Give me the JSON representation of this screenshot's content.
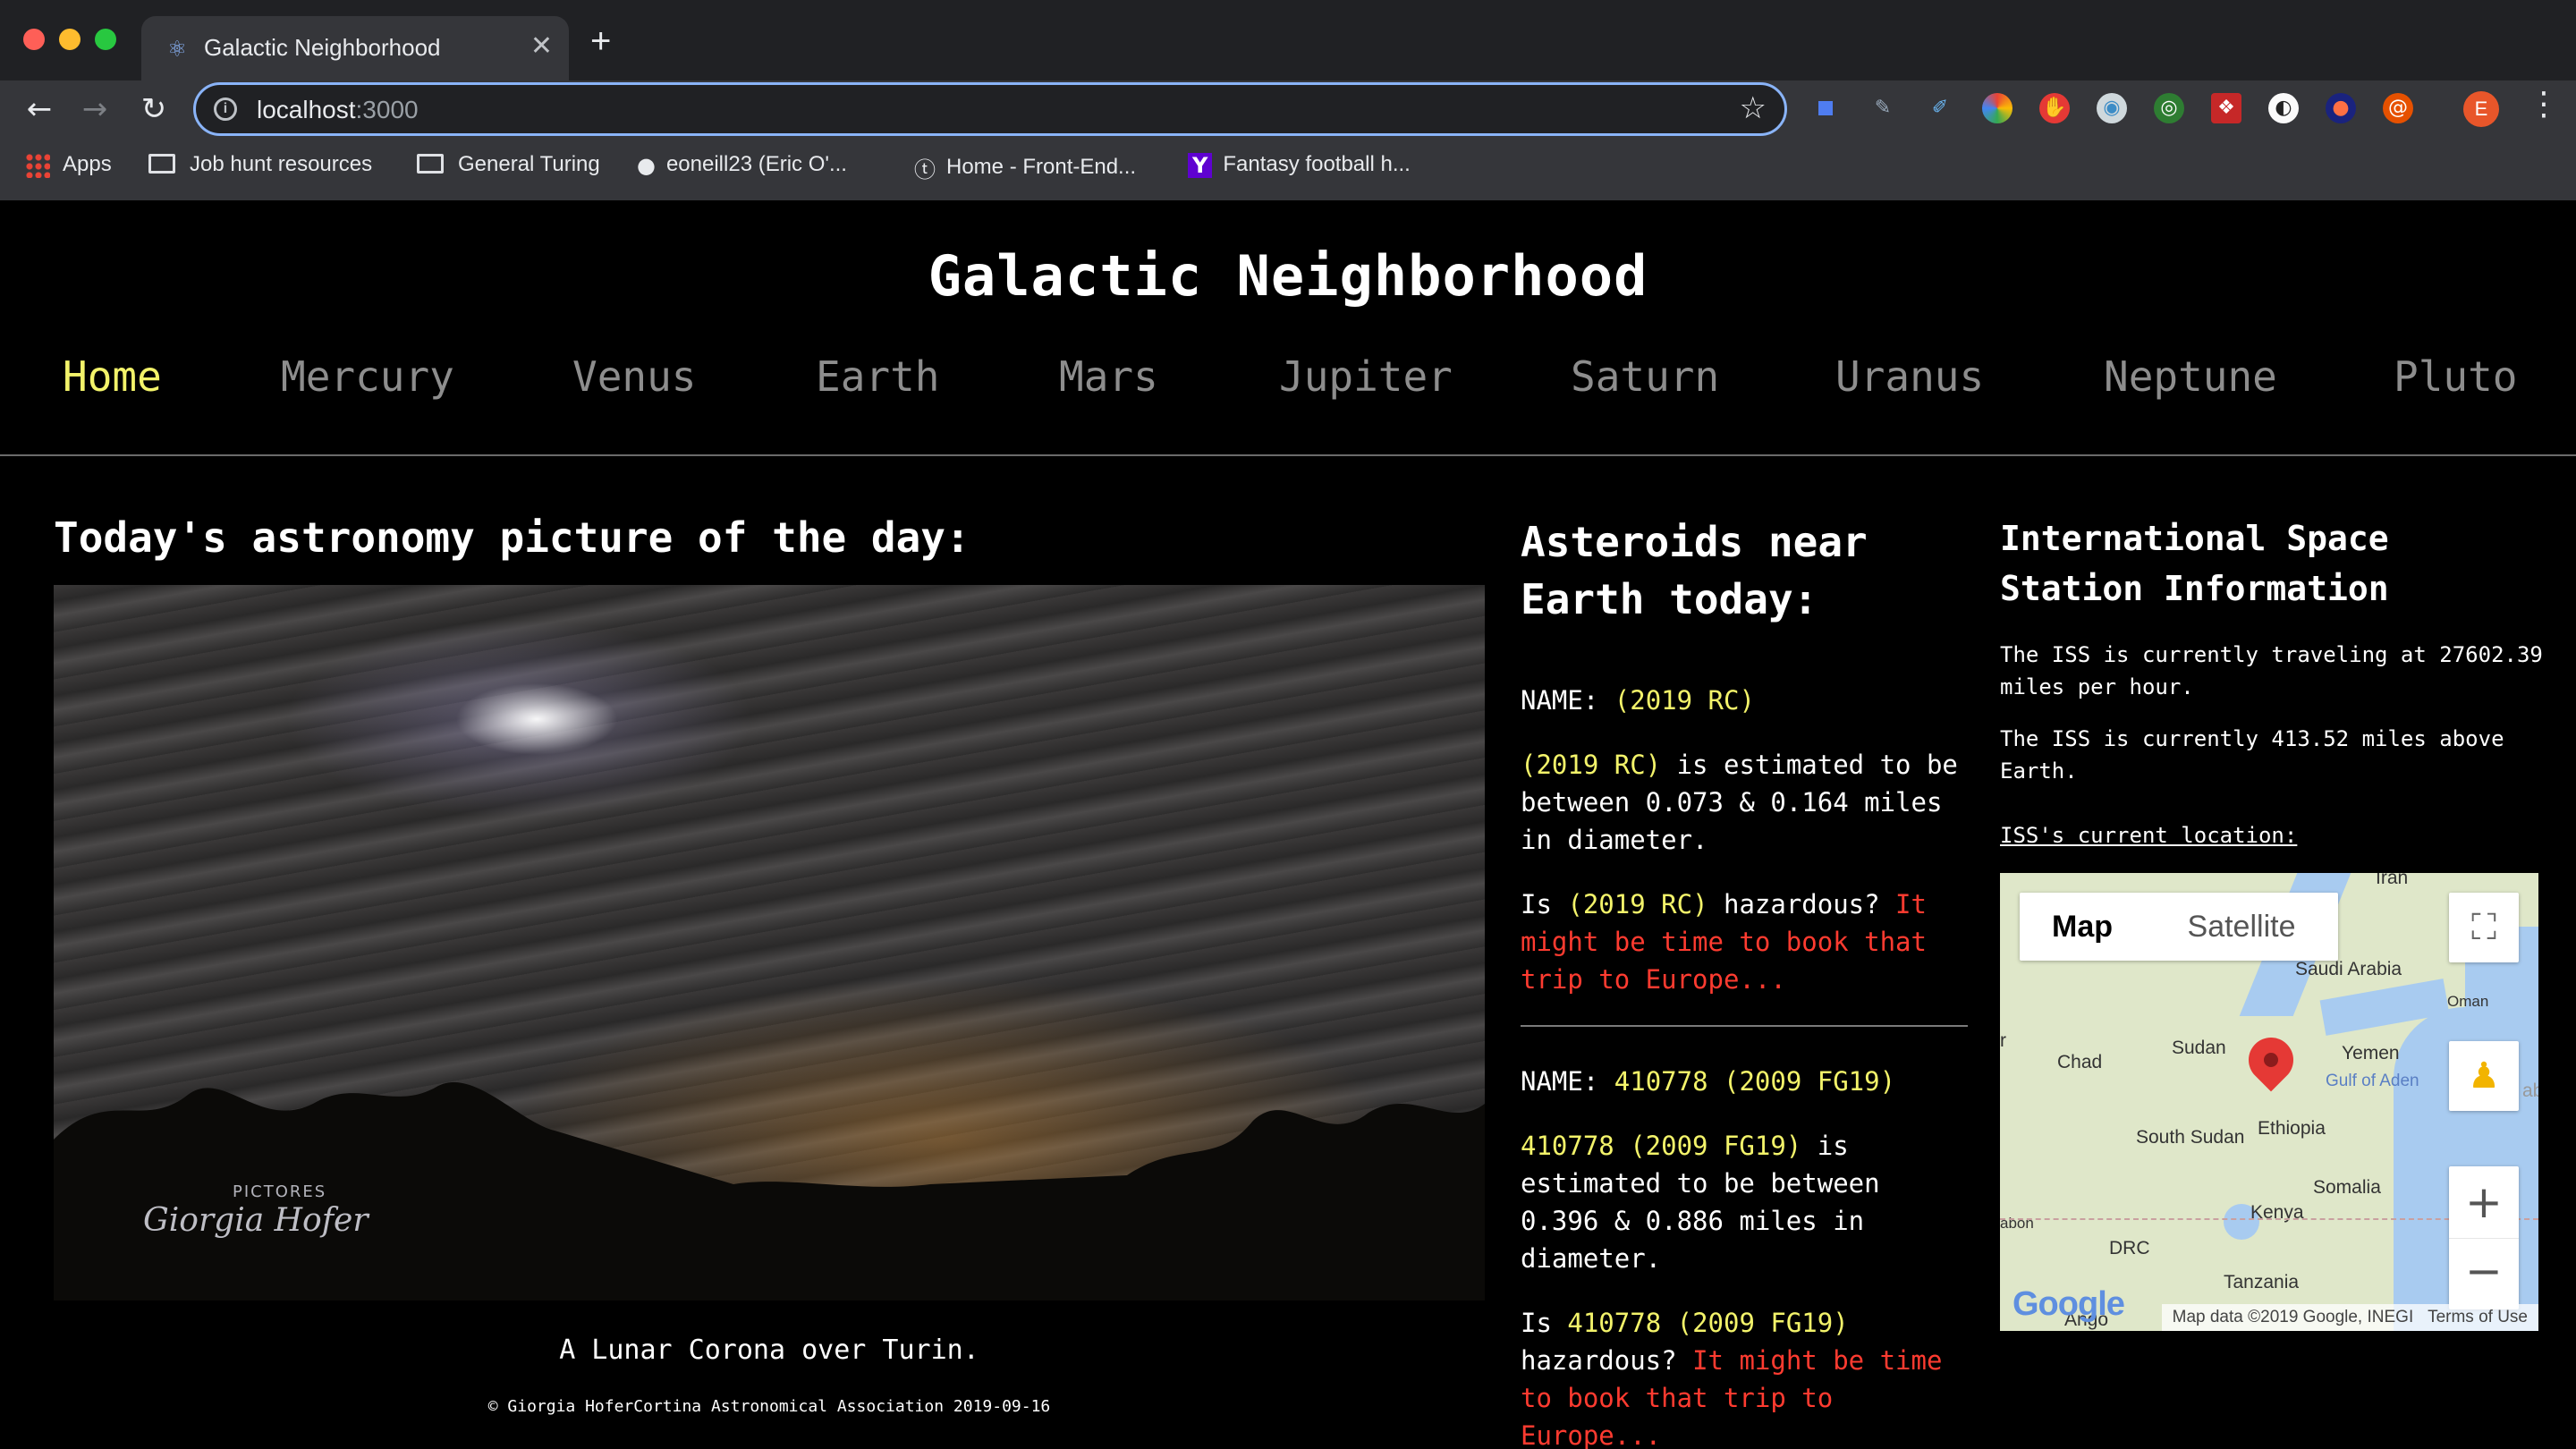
{
  "browser": {
    "tab_title": "Galactic Neighborhood",
    "url_host": "localhost",
    "url_port": ":3000",
    "bookmarks": [
      {
        "label": "Apps",
        "icon": "apps-grid-icon"
      },
      {
        "label": "Job hunt resources",
        "icon": "folder-icon"
      },
      {
        "label": "General Turing",
        "icon": "folder-icon"
      },
      {
        "label": "eoneill23 (Eric O'...",
        "icon": "github-icon"
      },
      {
        "label": "Home - Front-End...",
        "icon": "turing-icon"
      },
      {
        "label": "Fantasy football h...",
        "icon": "yahoo-icon"
      }
    ],
    "profile_initial": "E"
  },
  "site": {
    "title": "Galactic Neighborhood",
    "nav": [
      "Home",
      "Mercury",
      "Venus",
      "Earth",
      "Mars",
      "Jupiter",
      "Saturn",
      "Uranus",
      "Neptune",
      "Pluto"
    ],
    "active_nav": "Home",
    "accent_color": "#f3f36a",
    "warning_color": "#ff3b30"
  },
  "apod": {
    "heading": "Today's astronomy picture of the day:",
    "watermark": "Giorgia Hofer",
    "logo_text": "PICTORES",
    "caption": "A Lunar Corona over Turin.",
    "credit": "© Giorgia HoferCortina Astronomical Association 2019-09-16"
  },
  "asteroids": {
    "heading": "Asteroids near Earth today:",
    "name_label": "NAME:",
    "items": [
      {
        "name": "(2019 RC)",
        "estimate_text": " is estimated to be between 0.073 & 0.164 miles in diameter.",
        "hazard_prefix": "Is ",
        "hazard_q": " hazardous? ",
        "hazard_answer": "It might be time to book that trip to Europe..."
      },
      {
        "name": "410778 (2009 FG19)",
        "estimate_text": " is estimated to be between 0.396 & 0.886 miles in diameter.",
        "hazard_prefix": "Is ",
        "hazard_q": " hazardous? ",
        "hazard_answer": "It might be time to book that trip to Europe..."
      }
    ]
  },
  "iss": {
    "heading": "International Space Station Information",
    "speed_text": "The ISS is currently traveling at 27602.39 miles per hour.",
    "altitude_text": "The ISS is currently 413.52 miles above Earth.",
    "location_label": "ISS's current location:",
    "map": {
      "type_map": "Map",
      "type_satellite": "Satellite",
      "labels": {
        "iran": "Iran",
        "saudi": "Saudi Arabia",
        "oman": "Oman",
        "chad": "Chad",
        "sudan": "Sudan",
        "yemen": "Yemen",
        "gulf": "Gulf of Aden",
        "south_sudan": "South Sudan",
        "ethiopia": "Ethiopia",
        "somalia": "Somalia",
        "kenya": "Kenya",
        "drc": "DRC",
        "tanzania": "Tanzania",
        "gabon": "abon",
        "angola": "Ango",
        "edge_r": "r",
        "edge_ab": "ab"
      },
      "google": "Google",
      "attribution": "Map data ©2019 Google, INEGI",
      "terms": "Terms of Use"
    }
  }
}
